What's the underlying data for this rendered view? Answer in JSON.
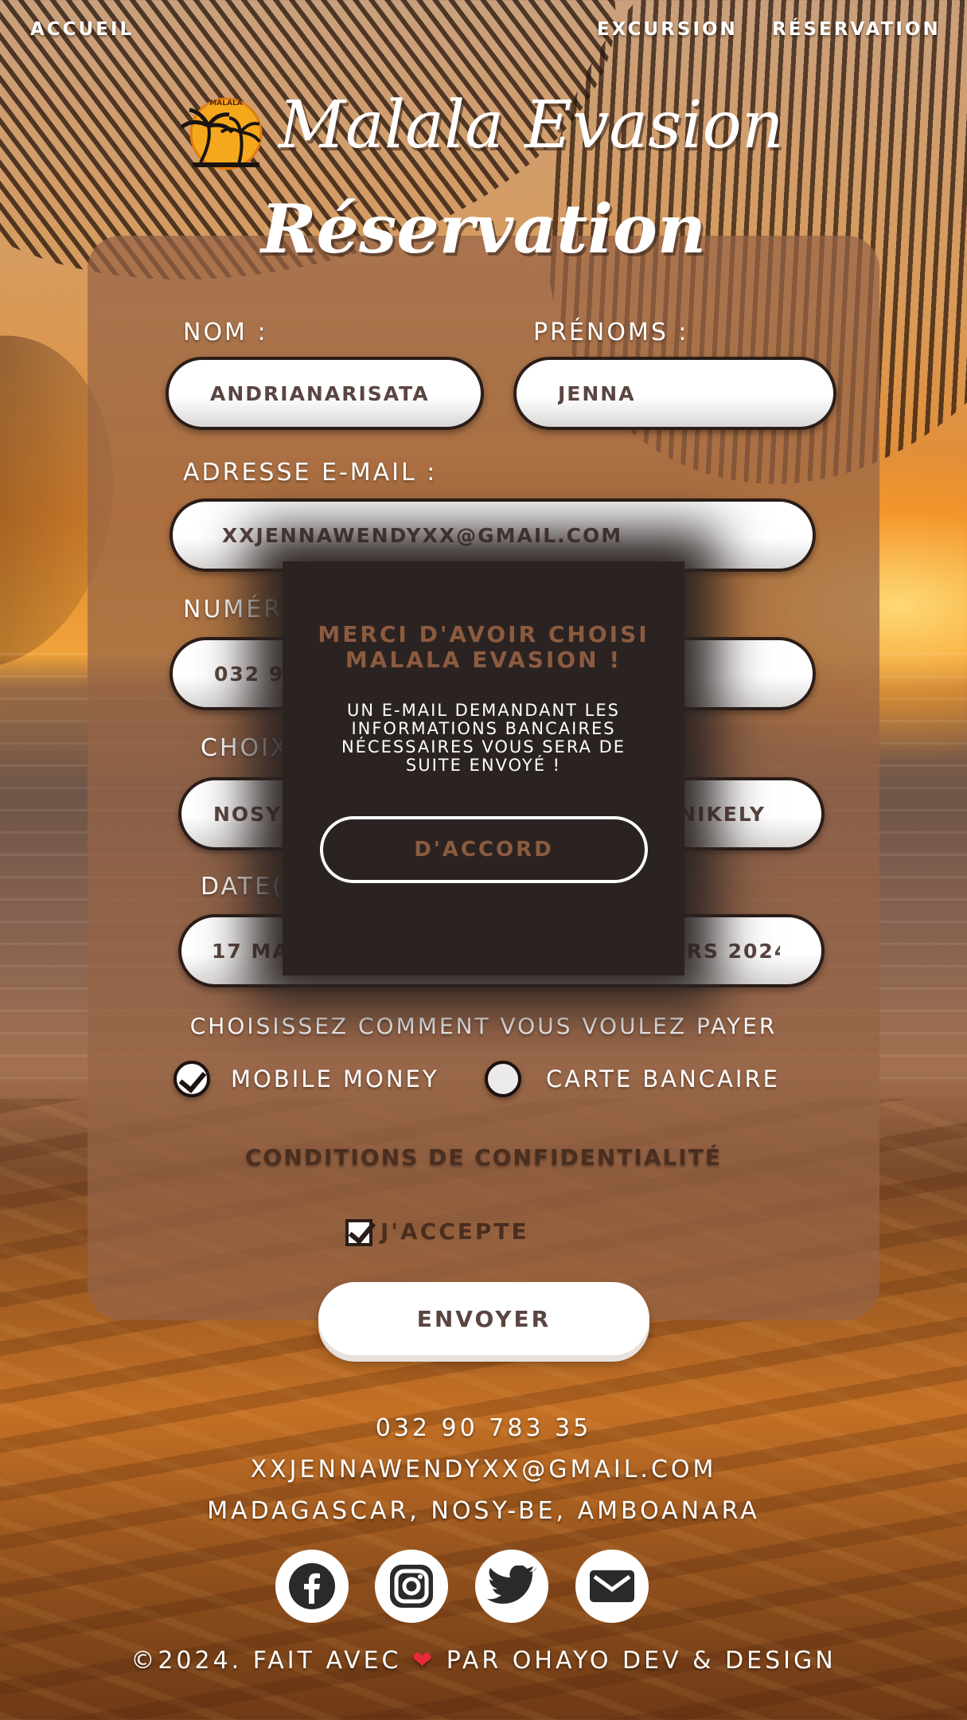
{
  "nav": {
    "home": "ACCUEIL",
    "excursion": "EXCURSION",
    "reservation": "RÉSERVATION"
  },
  "brand": {
    "title": "Malala Evasion",
    "logo_text": "MALALA"
  },
  "page": {
    "title": "Réservation"
  },
  "form": {
    "nom_label": "NOM :",
    "nom_value": "ANDRIANARISATA",
    "prenoms_label": "PRÉNOMS :",
    "prenoms_value": "JENNA",
    "email_label": "ADRESSE E-MAIL :",
    "email_value": "XXJENNAWENDYXX@GMAIL.COM",
    "numero_label": "NUMÉRO",
    "numero_value": "032 90 7",
    "choix_label": "CHOIX",
    "choix_value_left": "NOSY K",
    "choix_value_right": "NIKELY",
    "dates_label": "DATE(S",
    "dates_value": "17 MARS 2024, 19 MARS 2024, 22 MARS 2024",
    "payment_title": "CHOISISSEZ COMMENT VOUS VOULEZ PAYER",
    "payment_options": [
      {
        "label": "MOBILE MONEY",
        "checked": true
      },
      {
        "label": "CARTE BANCAIRE",
        "checked": false
      }
    ],
    "privacy": "CONDITIONS DE CONFIDENTIALITÉ",
    "accept": "J'ACCEPTE",
    "accept_checked": true,
    "submit": "ENVOYER"
  },
  "modal": {
    "title": "MERCI D'AVOIR CHOISI MALALA EVASION !",
    "text": "UN E-MAIL DEMANDANT LES INFORMATIONS BANCAIRES NÉCESSAIRES VOUS SERA DE SUITE ENVOYÉ !",
    "button": "D'ACCORD"
  },
  "footer": {
    "phone": "032 90 783 35",
    "email": "XXJENNAWENDYXX@GMAIL.COM",
    "address": "MADAGASCAR, NOSY-BE, AMBOANARA",
    "social": [
      "facebook-icon",
      "instagram-icon",
      "twitter-icon",
      "mail-icon"
    ],
    "copyright_prefix": "©2024. FAIT AVEC",
    "copyright_suffix": "PAR OHAYO DEV & DESIGN"
  },
  "colors": {
    "accent_brown": "#8c5b3f",
    "text_dark": "#5a4540",
    "heart": "#e52a3a"
  }
}
